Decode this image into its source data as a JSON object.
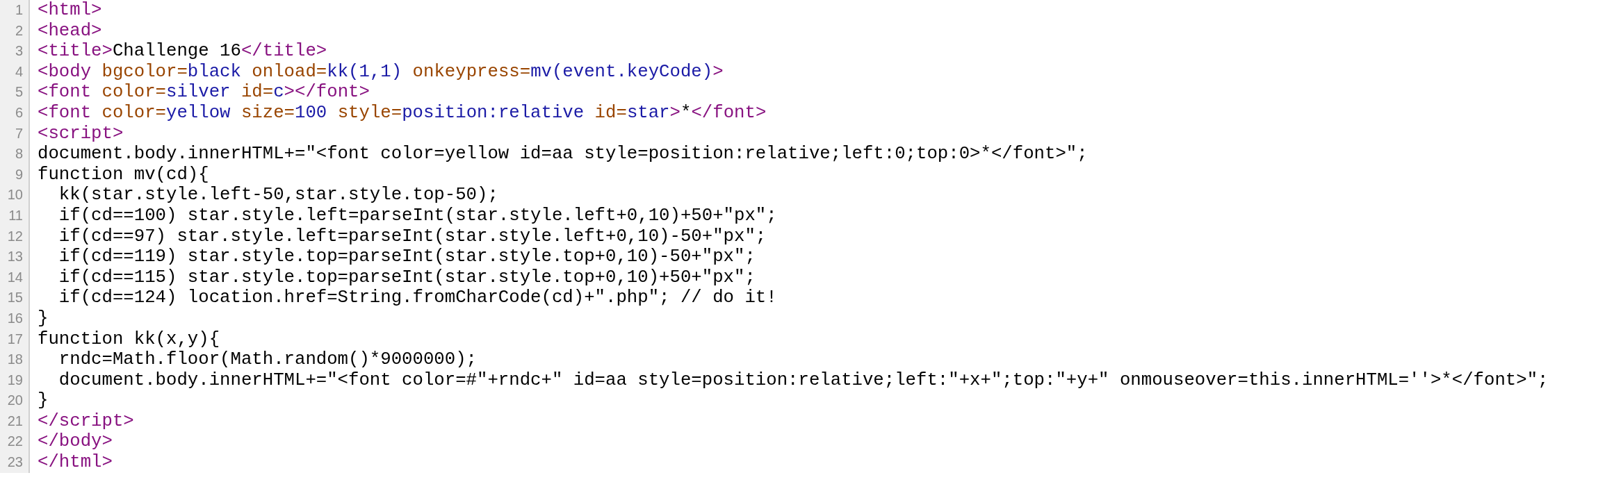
{
  "source_lines": [
    {
      "number": "1",
      "tokens": [
        {
          "kind": "tag",
          "text": "<html>"
        }
      ]
    },
    {
      "number": "2",
      "tokens": [
        {
          "kind": "tag",
          "text": "<head>"
        }
      ]
    },
    {
      "number": "3",
      "tokens": [
        {
          "kind": "tag",
          "text": "<title>"
        },
        {
          "kind": "text",
          "text": "Challenge 16"
        },
        {
          "kind": "tag",
          "text": "</title>"
        }
      ]
    },
    {
      "number": "4",
      "tokens": [
        {
          "kind": "tag",
          "text": "<body"
        },
        {
          "kind": "attr",
          "text": " bgcolor="
        },
        {
          "kind": "value",
          "text": "black"
        },
        {
          "kind": "attr",
          "text": " onload="
        },
        {
          "kind": "value",
          "text": "kk(1,1)"
        },
        {
          "kind": "attr",
          "text": " onkeypress="
        },
        {
          "kind": "value",
          "text": "mv(event.keyCode)"
        },
        {
          "kind": "tag",
          "text": ">"
        }
      ]
    },
    {
      "number": "5",
      "tokens": [
        {
          "kind": "tag",
          "text": "<font"
        },
        {
          "kind": "attr",
          "text": " color="
        },
        {
          "kind": "value",
          "text": "silver"
        },
        {
          "kind": "attr",
          "text": " id="
        },
        {
          "kind": "value",
          "text": "c"
        },
        {
          "kind": "tag",
          "text": "></font>"
        }
      ]
    },
    {
      "number": "6",
      "tokens": [
        {
          "kind": "tag",
          "text": "<font"
        },
        {
          "kind": "attr",
          "text": " color="
        },
        {
          "kind": "value",
          "text": "yellow"
        },
        {
          "kind": "attr",
          "text": " size="
        },
        {
          "kind": "value",
          "text": "100"
        },
        {
          "kind": "attr",
          "text": " style="
        },
        {
          "kind": "value",
          "text": "position:relative"
        },
        {
          "kind": "attr",
          "text": " id="
        },
        {
          "kind": "value",
          "text": "star"
        },
        {
          "kind": "tag",
          "text": ">"
        },
        {
          "kind": "text",
          "text": "*"
        },
        {
          "kind": "tag",
          "text": "</font>"
        }
      ]
    },
    {
      "number": "7",
      "tokens": [
        {
          "kind": "tag",
          "text": "<script>"
        }
      ]
    },
    {
      "number": "8",
      "tokens": [
        {
          "kind": "text",
          "text": "document.body.innerHTML+=\"<font color=yellow id=aa style=position:relative;left:0;top:0>*</font>\";"
        }
      ]
    },
    {
      "number": "9",
      "tokens": [
        {
          "kind": "text",
          "text": "function mv(cd){"
        }
      ]
    },
    {
      "number": "10",
      "tokens": [
        {
          "kind": "text",
          "text": "  kk(star.style.left-50,star.style.top-50);"
        }
      ]
    },
    {
      "number": "11",
      "tokens": [
        {
          "kind": "text",
          "text": "  if(cd==100) star.style.left=parseInt(star.style.left+0,10)+50+\"px\";"
        }
      ]
    },
    {
      "number": "12",
      "tokens": [
        {
          "kind": "text",
          "text": "  if(cd==97) star.style.left=parseInt(star.style.left+0,10)-50+\"px\";"
        }
      ]
    },
    {
      "number": "13",
      "tokens": [
        {
          "kind": "text",
          "text": "  if(cd==119) star.style.top=parseInt(star.style.top+0,10)-50+\"px\";"
        }
      ]
    },
    {
      "number": "14",
      "tokens": [
        {
          "kind": "text",
          "text": "  if(cd==115) star.style.top=parseInt(star.style.top+0,10)+50+\"px\";"
        }
      ]
    },
    {
      "number": "15",
      "tokens": [
        {
          "kind": "text",
          "text": "  if(cd==124) location.href=String.fromCharCode(cd)+\".php\"; // do it!"
        }
      ]
    },
    {
      "number": "16",
      "tokens": [
        {
          "kind": "text",
          "text": "}"
        }
      ]
    },
    {
      "number": "17",
      "tokens": [
        {
          "kind": "text",
          "text": "function kk(x,y){"
        }
      ]
    },
    {
      "number": "18",
      "tokens": [
        {
          "kind": "text",
          "text": "  rndc=Math.floor(Math.random()*9000000);"
        }
      ]
    },
    {
      "number": "19",
      "tokens": [
        {
          "kind": "text",
          "text": "  document.body.innerHTML+=\"<font color=#\"+rndc+\" id=aa style=position:relative;left:\"+x+\";top:\"+y+\" onmouseover=this.innerHTML=''>*</font>\";"
        }
      ]
    },
    {
      "number": "20",
      "tokens": [
        {
          "kind": "text",
          "text": "}"
        }
      ]
    },
    {
      "number": "21",
      "tokens": [
        {
          "kind": "tag",
          "text": "</script>"
        }
      ]
    },
    {
      "number": "22",
      "tokens": [
        {
          "kind": "tag",
          "text": "</body>"
        }
      ]
    },
    {
      "number": "23",
      "tokens": [
        {
          "kind": "tag",
          "text": "</html>"
        }
      ]
    }
  ]
}
